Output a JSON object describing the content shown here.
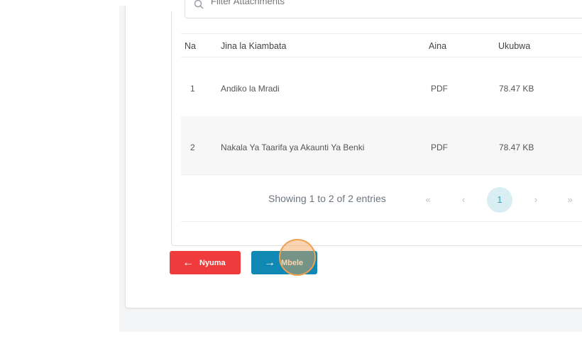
{
  "search": {
    "placeholder": "Filter Attachments"
  },
  "table": {
    "headers": {
      "no": "Na",
      "name": "Jina la Kiambata",
      "type": "Aina",
      "size": "Ukubwa"
    },
    "rows": [
      {
        "no": "1",
        "name": "Andiko la Mradi",
        "type": "PDF",
        "size": "78.47 KB"
      },
      {
        "no": "2",
        "name": "Nakala Ya Taarifa ya Akaunti Ya Benki",
        "type": "PDF",
        "size": "78.47 KB"
      }
    ]
  },
  "pagination": {
    "summary": "Showing 1 to 2 of 2 entries",
    "first": "«",
    "prev": "‹",
    "current": "1",
    "next": "›",
    "last": "»"
  },
  "buttons": {
    "back": "Nyuma",
    "next": "Mbele"
  },
  "colors": {
    "back": "#ef3b3b",
    "next": "#0f89b4",
    "active_page": "#d9eef2"
  }
}
